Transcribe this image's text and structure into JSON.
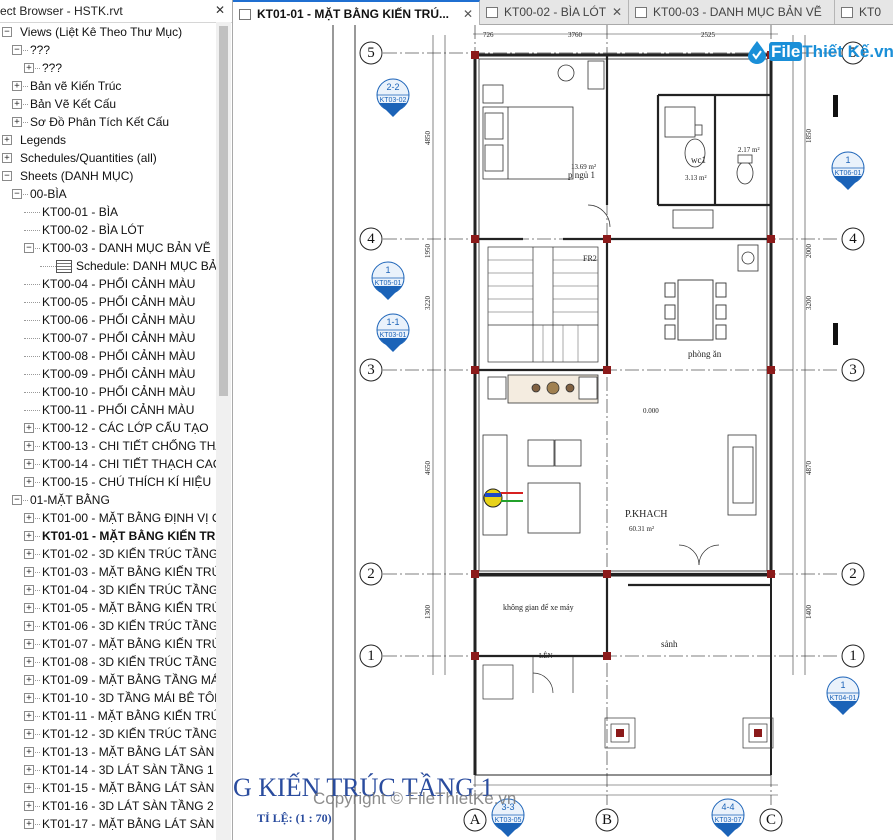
{
  "browser": {
    "title": "ect Browser - HSTK.rvt",
    "close": "✕",
    "items": [
      {
        "label": "Views (Liệt Kê Theo Thư Mục)",
        "level": 0,
        "exp": "−"
      },
      {
        "label": "???",
        "level": 1,
        "exp": "−"
      },
      {
        "label": "???",
        "level": 2,
        "exp": "+"
      },
      {
        "label": "Bản vẽ Kiến Trúc",
        "level": 1,
        "exp": "+"
      },
      {
        "label": "Bản Vẽ Kết Cấu",
        "level": 1,
        "exp": "+"
      },
      {
        "label": "Sơ Đồ Phân Tích Kết Cấu",
        "level": 1,
        "exp": "+"
      },
      {
        "label": "Legends",
        "level": 0,
        "exp": "+"
      },
      {
        "label": "Schedules/Quantities (all)",
        "level": 0,
        "exp": "+"
      },
      {
        "label": "Sheets (DANH MỤC)",
        "level": 0,
        "exp": "−"
      },
      {
        "label": "00-BÌA",
        "level": 1,
        "exp": "−"
      },
      {
        "label": "KT00-01 - BÌA",
        "level": 2,
        "exp": ""
      },
      {
        "label": "KT00-02 - BÌA LÓT",
        "level": 2,
        "exp": ""
      },
      {
        "label": "KT00-03 - DANH MỤC BẢN VẼ",
        "level": 2,
        "exp": "−"
      },
      {
        "label": "Schedule: DANH MỤC BẢ",
        "level": 3,
        "exp": "",
        "icon": "schedule"
      },
      {
        "label": "KT00-04 - PHỐI CẢNH MÀU",
        "level": 2,
        "exp": ""
      },
      {
        "label": "KT00-05 - PHỐI CẢNH MÀU",
        "level": 2,
        "exp": ""
      },
      {
        "label": "KT00-06 - PHỐI CẢNH MÀU",
        "level": 2,
        "exp": ""
      },
      {
        "label": "KT00-07 - PHỐI CẢNH MÀU",
        "level": 2,
        "exp": ""
      },
      {
        "label": "KT00-08 - PHỐI CẢNH MÀU",
        "level": 2,
        "exp": ""
      },
      {
        "label": "KT00-09 - PHỐI CẢNH MÀU",
        "level": 2,
        "exp": ""
      },
      {
        "label": "KT00-10 - PHỐI CẢNH MÀU",
        "level": 2,
        "exp": ""
      },
      {
        "label": "KT00-11 - PHỐI CẢNH MÀU",
        "level": 2,
        "exp": ""
      },
      {
        "label": "KT00-12 - CÁC LỚP CẤU TẠO",
        "level": 2,
        "exp": "+"
      },
      {
        "label": "KT00-13 - CHI TIẾT CHỐNG THẤ",
        "level": 2,
        "exp": "+"
      },
      {
        "label": "KT00-14 - CHI TIẾT THẠCH CAC",
        "level": 2,
        "exp": "+"
      },
      {
        "label": "KT00-15 - CHÚ THÍCH KÍ HIỆU",
        "level": 2,
        "exp": "+"
      },
      {
        "label": "01-MẶT BẰNG",
        "level": 1,
        "exp": "−"
      },
      {
        "label": "KT01-00 - MẶT BẰNG ĐỊNH VỊ C",
        "level": 2,
        "exp": "+"
      },
      {
        "label": "KT01-01 - MẶT BẰNG KIẾN TR",
        "level": 2,
        "exp": "+",
        "bold": true
      },
      {
        "label": "KT01-02 - 3D KIẾN TRÚC TẦNG 1",
        "level": 2,
        "exp": "+"
      },
      {
        "label": "KT01-03 - MẶT BẰNG KIẾN TRÚC",
        "level": 2,
        "exp": "+"
      },
      {
        "label": "KT01-04 - 3D KIẾN TRÚC TẦNG 2",
        "level": 2,
        "exp": "+"
      },
      {
        "label": "KT01-05 - MẶT BẰNG KIẾN TRÚC",
        "level": 2,
        "exp": "+"
      },
      {
        "label": "KT01-06 - 3D KIẾN TRÚC TẦNG 3",
        "level": 2,
        "exp": "+"
      },
      {
        "label": "KT01-07 - MẶT BẰNG KIẾN TRÚC",
        "level": 2,
        "exp": "+"
      },
      {
        "label": "KT01-08 - 3D KIẾN TRÚC TẦNG 4",
        "level": 2,
        "exp": "+"
      },
      {
        "label": "KT01-09 - MẶT BẰNG TẦNG MÁ",
        "level": 2,
        "exp": "+"
      },
      {
        "label": "KT01-10 - 3D TẦNG MÁI BÊ TÔN",
        "level": 2,
        "exp": "+"
      },
      {
        "label": "KT01-11 - MẶT BẰNG KIẾN TRÚC",
        "level": 2,
        "exp": "+"
      },
      {
        "label": "KT01-12 - 3D KIẾN TRÚC TẦNG M",
        "level": 2,
        "exp": "+"
      },
      {
        "label": "KT01-13 - MẶT BẰNG LÁT SÀN T",
        "level": 2,
        "exp": "+"
      },
      {
        "label": "KT01-14 - 3D LÁT SÀN TẦNG 1",
        "level": 2,
        "exp": "+"
      },
      {
        "label": "KT01-15 - MẶT BẰNG LÁT SÀN T",
        "level": 2,
        "exp": "+"
      },
      {
        "label": "KT01-16 - 3D LÁT SÀN TẦNG 2",
        "level": 2,
        "exp": "+"
      },
      {
        "label": "KT01-17 - MẶT BẰNG LÁT SÀN T",
        "level": 2,
        "exp": "+"
      }
    ]
  },
  "tabs": [
    {
      "label": "KT01-01 - MẶT BẰNG KIẾN TRÚ...",
      "active": true,
      "close": "✕"
    },
    {
      "label": "KT00-02 - BÌA LÓT",
      "active": false,
      "close": "✕"
    },
    {
      "label": "KT00-03 - DANH MỤC BẢN VẼ",
      "active": false,
      "close": ""
    },
    {
      "label": "KT0",
      "active": false,
      "close": ""
    }
  ],
  "logo": {
    "file": "File",
    "rest": "Thiết Kế.vn"
  },
  "drawing": {
    "grid_rows": [
      "5",
      "4",
      "3",
      "2",
      "1"
    ],
    "grid_cols": [
      "A",
      "B",
      "C"
    ],
    "room_bed": "p ngủ 1",
    "room_bed_area": "13.69 m²",
    "room_wc": "wc1",
    "room_wc_area": "3.13 m²",
    "room_wc_area2": "2.17 m²",
    "room_dining": "phòng ăn",
    "room_living": "P.KHACH",
    "room_living_area": "60.31 m²",
    "room_parking": "không gian để xe máy",
    "room_lobby": "sảnh",
    "level_mark": "0.000",
    "stair_label": "LÊN",
    "fr_label": "FR2",
    "sections": [
      {
        "top": "2-2",
        "bottom": "KT03-02"
      },
      {
        "top": "1",
        "bottom": "KT05-01"
      },
      {
        "top": "1-1",
        "bottom": "KT03-01"
      },
      {
        "top": "1",
        "bottom": "KT06-01"
      },
      {
        "top": "1",
        "bottom": "KT04-01"
      },
      {
        "top": "3-3",
        "bottom": "KT03-05"
      },
      {
        "top": "4-4",
        "bottom": "KT03-07"
      }
    ],
    "dims_top": [
      "726",
      "3760",
      "2525"
    ],
    "dims_left": [
      "4850",
      "1950",
      "3220",
      "4650",
      "1300"
    ],
    "dims_right": [
      "1850",
      "2000",
      "3200",
      "4870",
      "1400"
    ],
    "title_text": "G KIẾN TRÚC TẦNG 1",
    "scale_text": "TỈ LỆ: (1 : 70)",
    "watermark": "Copyright © FileThietKe.vn"
  },
  "colors": {
    "accent": "#1f6fd1",
    "annotation_blue": "#1b63b8",
    "title_blue": "#2a4c9e",
    "column_red": "#8b1a1a"
  }
}
